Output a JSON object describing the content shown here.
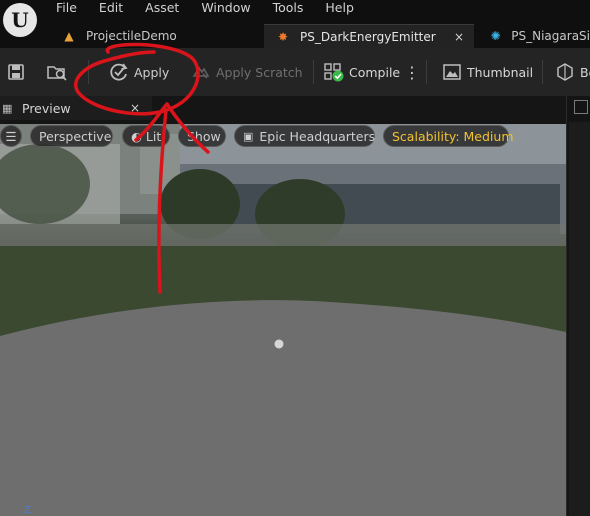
{
  "app": {
    "logo_icon": "unreal-engine-logo-icon"
  },
  "menu": {
    "items": [
      "File",
      "Edit",
      "Asset",
      "Window",
      "Tools",
      "Help"
    ]
  },
  "tabs": [
    {
      "label": "ProjectileDemo",
      "icon": "project-icon",
      "icon_color": "#e8a33a"
    },
    {
      "label": "PS_DarkEnergyEmitter",
      "icon": "particle-system-icon",
      "icon_color": "#f07a2c",
      "close": "×"
    },
    {
      "label": "PS_NiagaraSi",
      "icon": "niagara-system-icon",
      "icon_color": "#3ab4e8"
    }
  ],
  "toolbar": {
    "apply_label": "Apply",
    "apply_scratch_label": "Apply Scratch",
    "compile_label": "Compile",
    "compile_options_glyph": "⋮",
    "thumbnail_label": "Thumbnail",
    "bounds_label_partial": "Bo"
  },
  "preview": {
    "title": "Preview",
    "close": "×"
  },
  "viewport_controls": {
    "perspective_label": "Perspective",
    "lit_label": "Lit",
    "show_label": "Show",
    "environment_label": "Epic Headquarters",
    "scalability_label": "Scalability: Medium"
  },
  "axis": {
    "z_label": "Z"
  },
  "annotation": {
    "color": "#d9141a"
  }
}
